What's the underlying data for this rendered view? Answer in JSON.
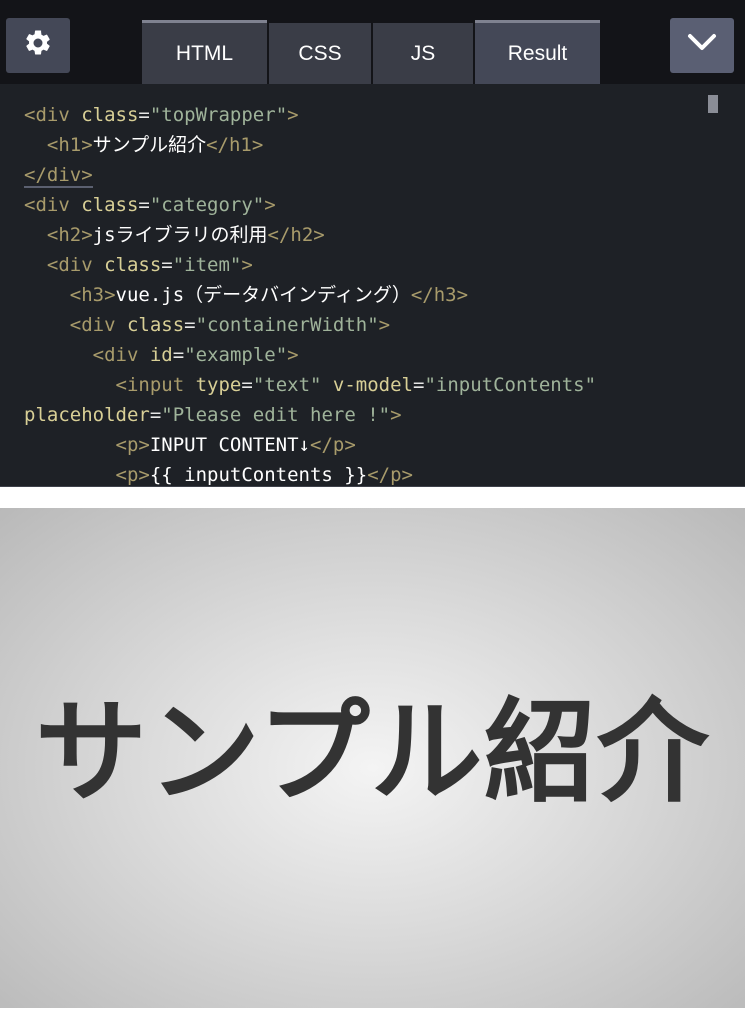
{
  "toolbar": {
    "settings_icon": "gear-icon",
    "collapse_icon": "chevron-down-icon",
    "tabs": [
      {
        "label": "HTML"
      },
      {
        "label": "CSS"
      },
      {
        "label": "JS"
      },
      {
        "label": "Result"
      }
    ]
  },
  "code_lines": [
    [
      "<div ",
      "class",
      "=",
      "\"topWrapper\"",
      ">"
    ],
    [
      "  <h1>",
      "サンプル紹介",
      "</h1>"
    ],
    [
      "</div>"
    ],
    [
      "<div ",
      "class",
      "=",
      "\"category\"",
      ">"
    ],
    [
      "  <h2>",
      "jsライブラリの利用",
      "</h2>"
    ],
    [
      "  <div ",
      "class",
      "=",
      "\"item\"",
      ">"
    ],
    [
      "    <h3>",
      "vue.js（データバインディング）",
      "</h3>"
    ],
    [
      "    <div ",
      "class",
      "=",
      "\"containerWidth\"",
      ">"
    ],
    [
      "      <div ",
      "id",
      "=",
      "\"example\"",
      ">"
    ],
    [
      "        <input ",
      "type",
      "=",
      "\"text\"",
      " ",
      "v-model",
      "=",
      "\"inputContents\""
    ],
    [
      "placeholder",
      "=",
      "\"Please edit here !\"",
      ">"
    ],
    [
      "        <p>",
      "INPUT CONTENT↓",
      "</p>"
    ],
    [
      "        <p>",
      "{{ inputContents }}",
      "</p>"
    ]
  ],
  "result": {
    "heading": "サンプル紹介"
  },
  "colors": {
    "editor_bg": "#1e2126",
    "tag": "#a89b6b",
    "attr": "#d8cf96",
    "string": "#9fb39a",
    "text": "#ffffff"
  }
}
